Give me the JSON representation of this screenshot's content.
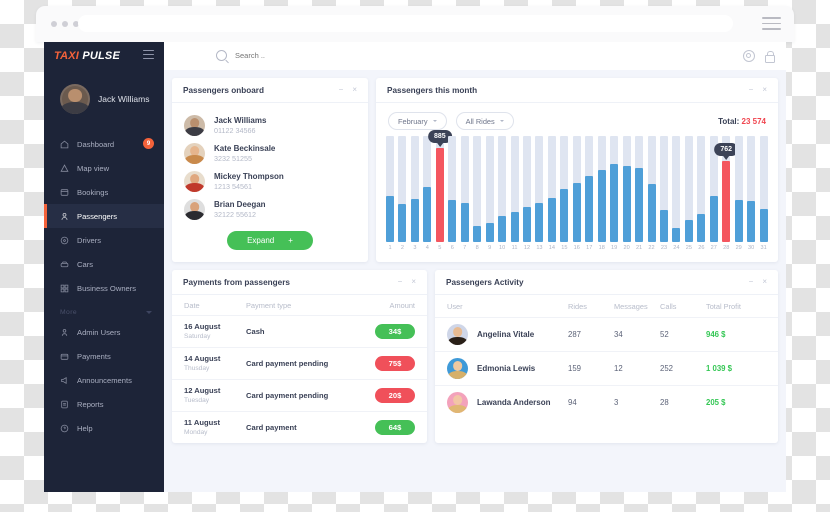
{
  "browser": {
    "hamburger_icon": "hamburger-icon",
    "url_value": ""
  },
  "topbar": {
    "search_placeholder": "Search ..",
    "search_value": "",
    "settings_icon": "gear-icon",
    "lock_icon": "lock-icon"
  },
  "sidebar": {
    "logo_part1": "TAXI",
    "logo_part2": "PULSE",
    "user": {
      "name": "Jack Williams"
    },
    "items": [
      {
        "label": "Dashboard",
        "icon": "home-icon",
        "active": false,
        "badge": "9"
      },
      {
        "label": "Map view",
        "icon": "map-pin-icon",
        "active": false,
        "badge": ""
      },
      {
        "label": "Bookings",
        "icon": "calendar-icon",
        "active": false,
        "badge": ""
      },
      {
        "label": "Passengers",
        "icon": "user-icon",
        "active": true,
        "badge": ""
      },
      {
        "label": "Drivers",
        "icon": "steering-wheel-icon",
        "active": false,
        "badge": ""
      },
      {
        "label": "Cars",
        "icon": "car-icon",
        "active": false,
        "badge": ""
      },
      {
        "label": "Business Owners",
        "icon": "grid-icon",
        "active": false,
        "badge": ""
      }
    ],
    "group_label": "More",
    "more_items": [
      {
        "label": "Admin Users",
        "icon": "admin-user-icon"
      },
      {
        "label": "Payments",
        "icon": "credit-card-icon"
      },
      {
        "label": "Announcements",
        "icon": "megaphone-icon"
      },
      {
        "label": "Reports",
        "icon": "report-icon"
      },
      {
        "label": "Help",
        "icon": "help-circle-icon"
      }
    ]
  },
  "onboard": {
    "title": "Passengers onboard",
    "minimize_icon": "minimize-icon",
    "close_icon": "close-icon",
    "passengers": [
      {
        "name": "Jack Williams",
        "phone": "01122 34566",
        "skin": "#b98f6e",
        "cloth": "#3c3c44",
        "bg": "#cdbba8"
      },
      {
        "name": "Kate Beckinsale",
        "phone": "3232 51255",
        "skin": "#e6b58d",
        "cloth": "#c98a4c",
        "bg": "#e4d2bd"
      },
      {
        "name": "Mickey Thompson",
        "phone": "1213 54561",
        "skin": "#e0a87f",
        "cloth": "#c0392b",
        "bg": "#e8ddcd"
      },
      {
        "name": "Brian Deegan",
        "phone": "32122 55612",
        "skin": "#d9a27a",
        "cloth": "#2b2b30",
        "bg": "#dedede"
      }
    ],
    "expand_label": "Expand",
    "expand_plus": "+"
  },
  "chart_card": {
    "title": "Passengers this month",
    "minimize_icon": "minimize-icon",
    "close_icon": "close-icon",
    "month_filter": "February",
    "rides_filter": "All Rides",
    "total_label": "Total:",
    "total_value": "23 574"
  },
  "chart_data": {
    "type": "bar",
    "title": "Passengers this month",
    "xlabel": "",
    "ylabel": "",
    "ylim": [
      0,
      1000
    ],
    "grid": false,
    "legend": "none",
    "categories": [
      "1",
      "2",
      "3",
      "4",
      "5",
      "6",
      "7",
      "8",
      "9",
      "10",
      "11",
      "12",
      "13",
      "14",
      "15",
      "16",
      "17",
      "18",
      "19",
      "20",
      "21",
      "22",
      "23",
      "24",
      "25",
      "26",
      "27",
      "28",
      "29",
      "30",
      "31"
    ],
    "values": [
      430,
      355,
      405,
      520,
      885,
      400,
      370,
      155,
      175,
      245,
      285,
      330,
      370,
      415,
      500,
      560,
      620,
      680,
      735,
      720,
      700,
      545,
      300,
      130,
      205,
      260,
      430,
      762,
      400,
      385,
      310
    ],
    "bar_color": "#4f9fd8",
    "highlight_color": "#f4565f",
    "track_color": "#dfe5f1",
    "highlighted": [
      {
        "index": 4,
        "label": "885"
      },
      {
        "index": 27,
        "label": "762"
      }
    ]
  },
  "payments": {
    "title": "Payments from passengers",
    "minimize_icon": "minimize-icon",
    "close_icon": "close-icon",
    "columns": [
      "Date",
      "Payment type",
      "Amount"
    ],
    "rows": [
      {
        "date": "16 August",
        "weekday": "Saturday",
        "type": "Cash",
        "amount": "34$",
        "status": "green"
      },
      {
        "date": "14 August",
        "weekday": "Thusday",
        "type": "Card payment pending",
        "amount": "75$",
        "status": "red"
      },
      {
        "date": "12 August",
        "weekday": "Tuesday",
        "type": "Card payment pending",
        "amount": "20$",
        "status": "red"
      },
      {
        "date": "11 August",
        "weekday": "Monday",
        "type": "Card payment",
        "amount": "64$",
        "status": "green"
      }
    ]
  },
  "activity": {
    "title": "Passengers Activity",
    "minimize_icon": "minimize-icon",
    "close_icon": "close-icon",
    "columns": [
      "User",
      "Rides",
      "Messages",
      "Calls",
      "Total Profit"
    ],
    "rows": [
      {
        "name": "Angelina Vitale",
        "rides": "287",
        "messages": "34",
        "calls": "52",
        "profit": "946 $",
        "skin": "#e8bb92",
        "hair": "#2a2018",
        "bg": "#cfd6e8"
      },
      {
        "name": "Edmonia Lewis",
        "rides": "159",
        "messages": "12",
        "calls": "252",
        "profit": "1 039 $",
        "skin": "#f0c9a0",
        "hair": "#d6b06a",
        "bg": "#3f9ad8"
      },
      {
        "name": "Lawanda Anderson",
        "rides": "94",
        "messages": "3",
        "calls": "28",
        "profit": "205 $",
        "skin": "#f2c6a5",
        "hair": "#e0b773",
        "bg": "#f3a2bb"
      }
    ]
  }
}
